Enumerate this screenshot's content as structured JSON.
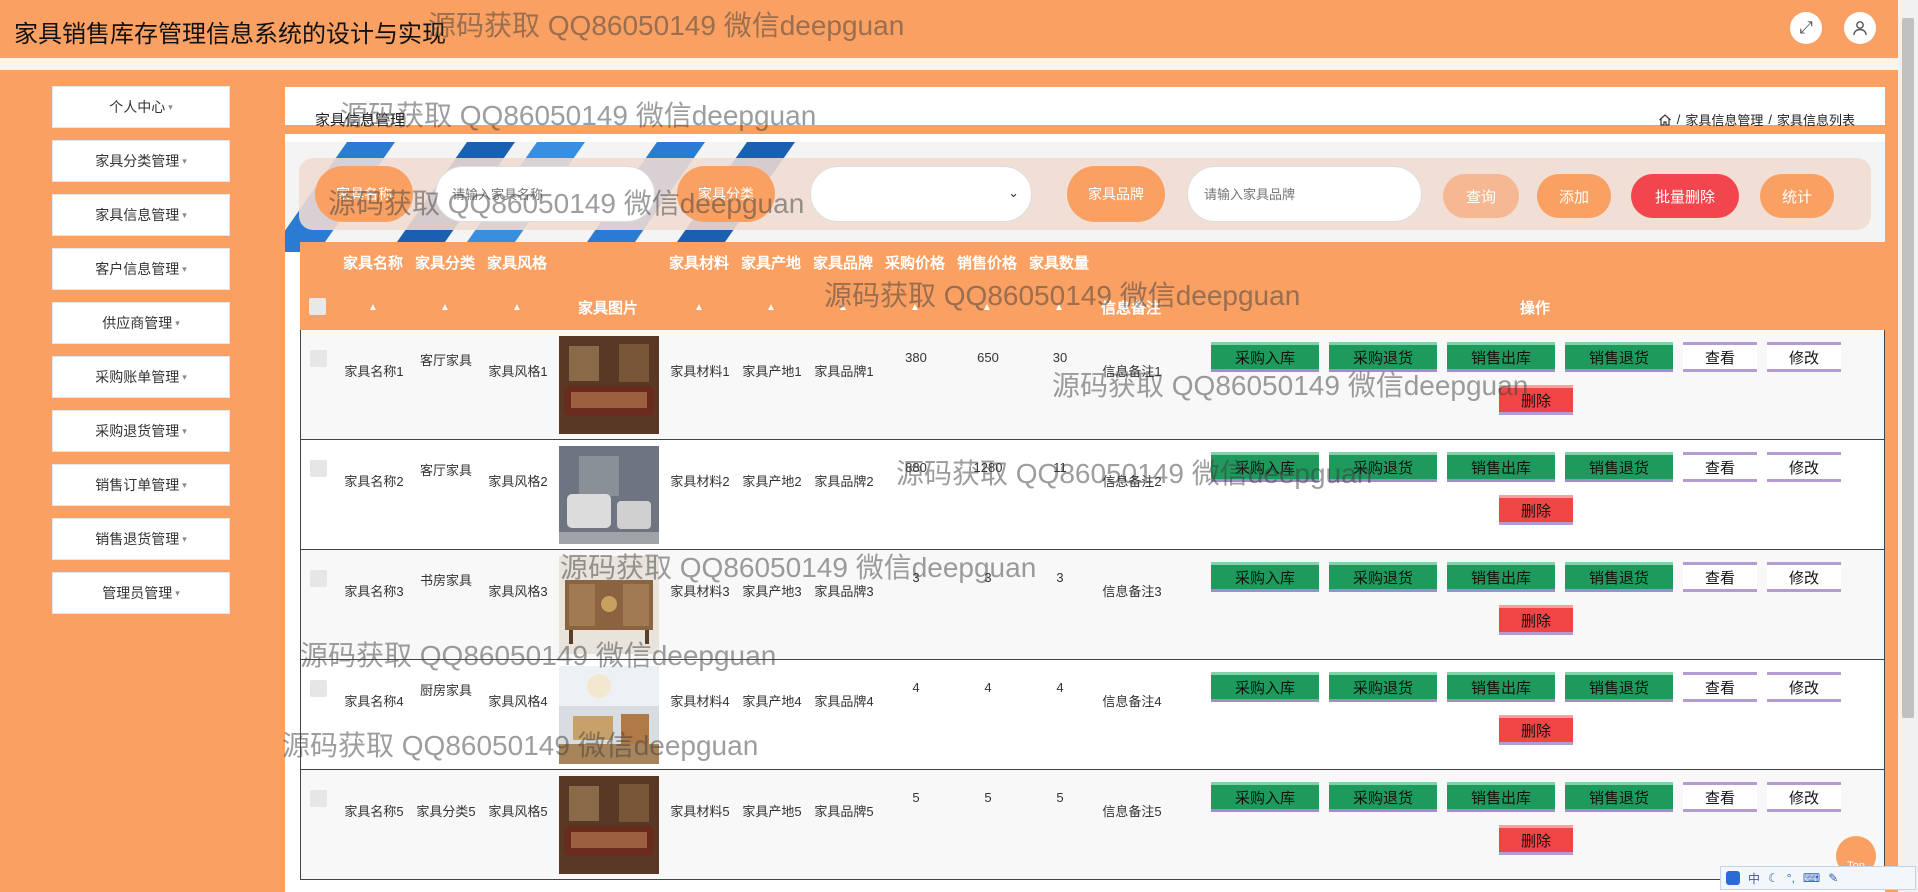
{
  "app": {
    "title": "家具销售库存管理信息系统的设计与实现",
    "fullscreen_icon": "expand-icon",
    "user_icon": "user-icon",
    "brand_color": "#f9a062"
  },
  "sidebar": {
    "items": [
      {
        "label": "个人中心"
      },
      {
        "label": "家具分类管理"
      },
      {
        "label": "家具信息管理"
      },
      {
        "label": "客户信息管理"
      },
      {
        "label": "供应商管理"
      },
      {
        "label": "采购账单管理"
      },
      {
        "label": "采购退货管理"
      },
      {
        "label": "销售订单管理"
      },
      {
        "label": "销售退货管理"
      },
      {
        "label": "管理员管理"
      }
    ]
  },
  "page": {
    "heading": "家具信息管理",
    "breadcrumb": [
      "家具信息管理",
      "家具信息列表"
    ]
  },
  "search": {
    "name_label": "家具名称",
    "name_placeholder": "请输入家具名称",
    "category_label": "家具分类",
    "category_value": "",
    "brand_label": "家具品牌",
    "brand_placeholder": "请输入家具品牌",
    "query_button": "查询",
    "add_button": "添加",
    "batch_delete_button": "批量删除",
    "stats_button": "统计"
  },
  "table": {
    "headers": {
      "name": "家具名称",
      "category": "家具分类",
      "style": "家具风格",
      "image": "家具图片",
      "material": "家具材料",
      "origin": "家具产地",
      "brand": "家具品牌",
      "purchase_price": "采购价格",
      "sale_price": "销售价格",
      "quantity": "家具数量",
      "remark": "信息备注",
      "actions": "操作"
    },
    "actions": {
      "purchase_in": "采购入库",
      "purchase_return": "采购退货",
      "sale_out": "销售出库",
      "sale_return": "销售退货",
      "view": "查看",
      "edit": "修改",
      "delete": "删除"
    },
    "rows": [
      {
        "name": "家具名称1",
        "category": "客厅家具",
        "style": "家具风格1",
        "material": "家具材料1",
        "origin": "家具产地1",
        "brand": "家具品牌1",
        "purchase_price": "380",
        "sale_price": "650",
        "quantity": "30",
        "remark": "信息备注1"
      },
      {
        "name": "家具名称2",
        "category": "客厅家具",
        "style": "家具风格2",
        "material": "家具材料2",
        "origin": "家具产地2",
        "brand": "家具品牌2",
        "purchase_price": "880",
        "sale_price": "1280",
        "quantity": "11",
        "remark": "信息备注2"
      },
      {
        "name": "家具名称3",
        "category": "书房家具",
        "style": "家具风格3",
        "material": "家具材料3",
        "origin": "家具产地3",
        "brand": "家具品牌3",
        "purchase_price": "3",
        "sale_price": "3",
        "quantity": "3",
        "remark": "信息备注3"
      },
      {
        "name": "家具名称4",
        "category": "厨房家具",
        "style": "家具风格4",
        "material": "家具材料4",
        "origin": "家具产地4",
        "brand": "家具品牌4",
        "purchase_price": "4",
        "sale_price": "4",
        "quantity": "4",
        "remark": "信息备注4"
      },
      {
        "name": "家具名称5",
        "category": "家具分类5",
        "style": "家具风格5",
        "material": "家具材料5",
        "origin": "家具产地5",
        "brand": "家具品牌5",
        "purchase_price": "5",
        "sale_price": "5",
        "quantity": "5",
        "remark": "信息备注5"
      }
    ]
  },
  "watermark": "源码获取 QQ86050149 微信deepguan",
  "top_button": "Top",
  "ime": {
    "label": "中"
  }
}
